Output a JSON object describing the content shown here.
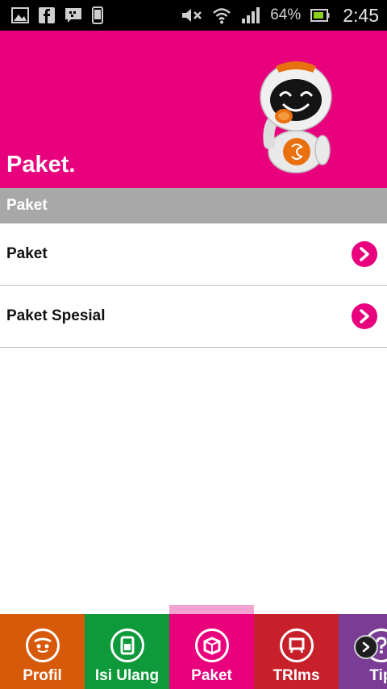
{
  "status_bar": {
    "battery_percent": "64%",
    "time": "2:45",
    "left_icons": [
      "gallery-icon",
      "facebook-icon",
      "bbm-icon",
      "phone-icon"
    ],
    "right_icons": [
      "mute-icon",
      "wifi-icon",
      "signal-icon",
      "battery-icon"
    ]
  },
  "header": {
    "title": "Paket.",
    "background": "#e8007d"
  },
  "section": {
    "title": "Paket"
  },
  "list": {
    "items": [
      {
        "label": "Paket",
        "icon": "chevron-right-icon"
      },
      {
        "label": "Paket Spesial",
        "icon": "chevron-right-icon"
      }
    ]
  },
  "tabs": [
    {
      "label": "Profil",
      "color": "#d75a0b",
      "icon": "profile-face-icon"
    },
    {
      "label": "Isi Ulang",
      "color": "#0e9a3b",
      "icon": "topup-card-icon"
    },
    {
      "label": "Paket",
      "color": "#e8007d",
      "icon": "package-box-icon",
      "selected": true
    },
    {
      "label": "TRIms",
      "color": "#c8202a",
      "icon": "trims-card-icon"
    },
    {
      "label": "Tip",
      "color": "#7a3c95",
      "icon": "tips-question-icon"
    }
  ],
  "colors": {
    "accent": "#e8007d",
    "section_header": "#a8a8a8",
    "indicator": "#f4a2cf"
  }
}
